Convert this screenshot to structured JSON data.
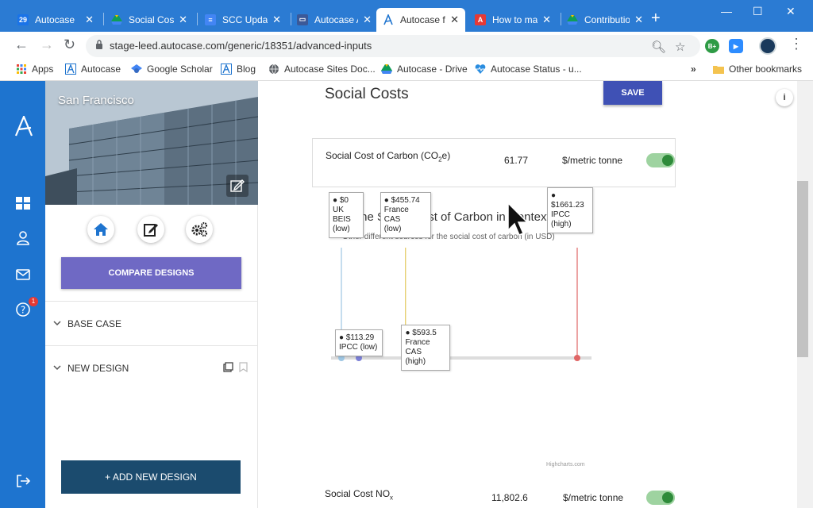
{
  "browser": {
    "tabs": [
      {
        "label": "Autocase",
        "icon_color": "#1a73e8",
        "icon_text": "29"
      },
      {
        "label": "Social Cost",
        "icon_color": "#0f9d58",
        "icon_text": ""
      },
      {
        "label": "SCC Updat",
        "icon_color": "#4285f4",
        "icon_text": ""
      },
      {
        "label": "Autocase A",
        "icon_color": "#3b5998",
        "icon_text": ""
      },
      {
        "label": "Autocase f",
        "icon_color": "#1e74cf",
        "icon_text": ""
      },
      {
        "label": "How to ma",
        "icon_color": "#e53935",
        "icon_text": ""
      },
      {
        "label": "Contributio",
        "icon_color": "#0f9d58",
        "icon_text": ""
      }
    ],
    "url": "stage-leed.autocase.com/generic/18351/advanced-inputs",
    "bookmarks": [
      {
        "label": "Apps"
      },
      {
        "label": "Autocase"
      },
      {
        "label": "Google Scholar"
      },
      {
        "label": "Blog"
      },
      {
        "label": "Autocase Sites Doc..."
      },
      {
        "label": "Autocase - Drive"
      },
      {
        "label": "Autocase Status - u..."
      }
    ],
    "other_bookmarks": "Other bookmarks",
    "more_bookmarks": "»",
    "extension_badge": "B+"
  },
  "sidebar": {
    "project_title": "San Francisco",
    "compare_label": "COMPARE DESIGNS",
    "sections": [
      {
        "label": "BASE CASE"
      },
      {
        "label": "NEW DESIGN"
      }
    ],
    "add_design_label": "+ ADD NEW DESIGN",
    "help_badge": "1"
  },
  "main": {
    "title": "Social Costs",
    "save_label": "SAVE",
    "info_label": "i",
    "carbon": {
      "label_prefix": "Social Cost of Carbon (CO",
      "label_sub": "2",
      "label_suffix": "e)",
      "value": "61.77",
      "unit": "$/metric tonne",
      "enabled": true
    },
    "nox": {
      "label_prefix": "Social Cost NO",
      "label_sub": "x",
      "value": "11,802.6",
      "unit": "$/metric tonne",
      "enabled": true
    }
  },
  "chart_data": {
    "type": "scatter",
    "title": "The Social Cost of Carbon in Context",
    "subtitle": "Other different sources for the social cost of carbon (in USD)",
    "credits": "Highcharts.com",
    "points": [
      {
        "value": 0,
        "value_label": "$0",
        "name_lines": [
          "UK BEIS",
          "(low)"
        ],
        "color": "#9ec6e3",
        "label_position": "above"
      },
      {
        "value": 113.29,
        "value_label": "$113.29",
        "name_lines": [
          "IPCC (low)"
        ],
        "color": "#7b7fd6",
        "label_position": "below"
      },
      {
        "value": 455.74,
        "value_label": "$455.74",
        "name_lines": [
          "France CAS",
          "(low)"
        ],
        "color": "#e3c85c",
        "label_position": "above"
      },
      {
        "value": 593.5,
        "value_label": "$593.5",
        "name_lines": [
          "France CAS",
          "(high)"
        ],
        "color": "#2e7f86",
        "label_position": "below"
      },
      {
        "value": 1661.23,
        "value_label": "$1661.23",
        "name_lines": [
          "IPCC",
          "(high)"
        ],
        "color": "#e06666",
        "label_position": "above"
      }
    ],
    "xlim": [
      0,
      1661.23
    ]
  }
}
